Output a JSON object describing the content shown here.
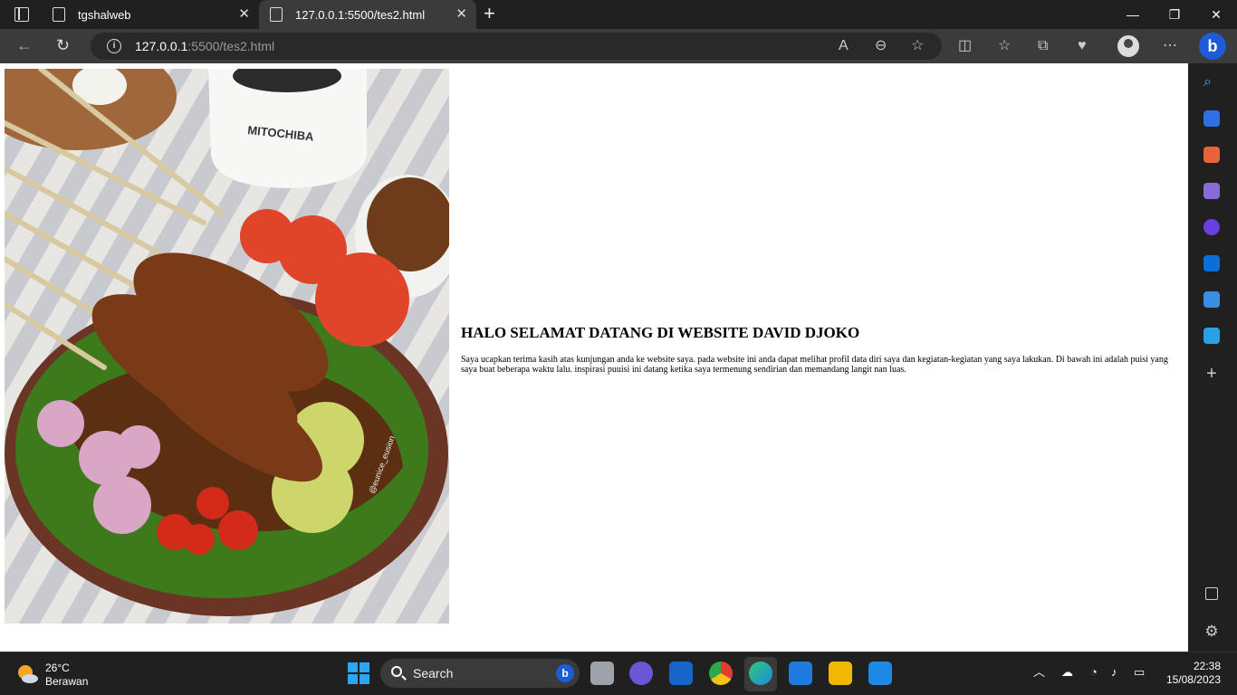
{
  "browser": {
    "tabs": [
      {
        "title": "tgshalweb",
        "active": false
      },
      {
        "title": "127.0.0.1:5500/tes2.html",
        "active": true
      }
    ],
    "address": {
      "host": "127.0.0.1",
      "path": ":5500/tes2.html"
    },
    "new_tab_label": "+"
  },
  "page": {
    "heading": "HALO SELAMAT DATANG DI WEBSITE DAVID DJOKO",
    "paragraph": "Saya ucapkan terima kasih atas kunjungan anda ke website saya. pada website ini anda dapat melihat profil data diri saya dan kegiatan-kegiatan yang saya lakukan. Di bawah ini adalah puisi yang saya buat beberapa waktu lalu. inspirasi puuisi ini datang ketika saya termenung sendirian dan memandang langit nan luas.",
    "image": {
      "subject": "sate-food-photo",
      "brand_text": "MITOCHIBA",
      "watermark": "@eunice_eusion"
    }
  },
  "taskbar": {
    "weather": {
      "temp": "26°C",
      "desc": "Berawan"
    },
    "search_label": "Search",
    "clock": {
      "time": "22:38",
      "date": "15/08/2023"
    }
  },
  "colors": {
    "accent": "#1e5bd8",
    "chrome_dark": "#202020",
    "toolbar": "#3b3b3b"
  }
}
